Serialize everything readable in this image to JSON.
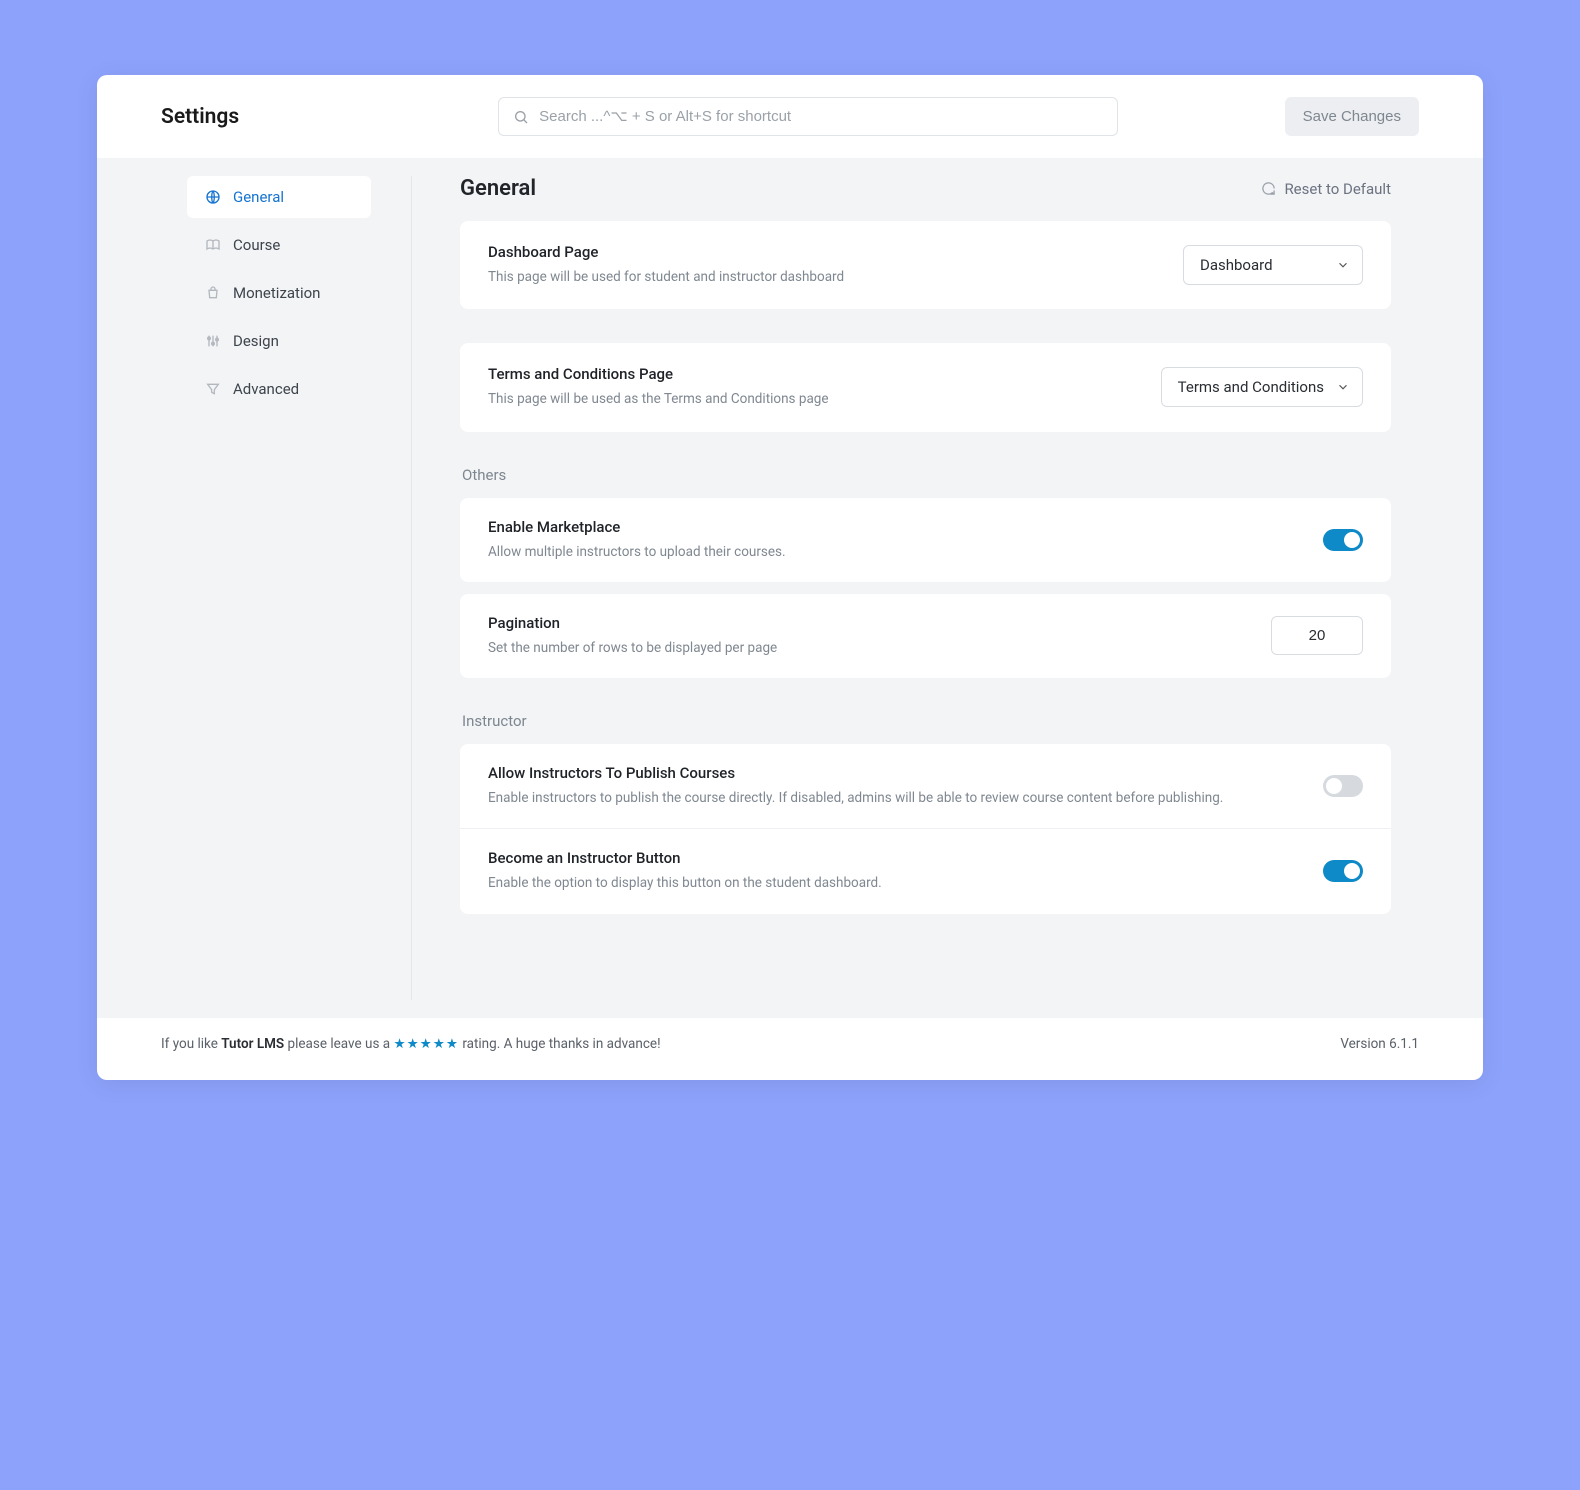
{
  "header": {
    "title": "Settings",
    "search_placeholder": "Search ...^⌥ + S or Alt+S for shortcut",
    "save_label": "Save Changes"
  },
  "sidebar": {
    "items": [
      {
        "id": "general",
        "label": "General",
        "active": true
      },
      {
        "id": "course",
        "label": "Course",
        "active": false
      },
      {
        "id": "monetization",
        "label": "Monetization",
        "active": false
      },
      {
        "id": "design",
        "label": "Design",
        "active": false
      },
      {
        "id": "advanced",
        "label": "Advanced",
        "active": false
      }
    ]
  },
  "main": {
    "title": "General",
    "reset_label": "Reset to Default",
    "rows": {
      "dashboard": {
        "title": "Dashboard Page",
        "desc": "This page will be used for student and instructor dashboard",
        "select_value": "Dashboard"
      },
      "terms": {
        "title": "Terms and Conditions Page",
        "desc": "This page will be used as the Terms and Conditions page",
        "select_value": "Terms and Conditions"
      }
    },
    "sections": {
      "others_label": "Others",
      "instructor_label": "Instructor"
    },
    "others": {
      "marketplace": {
        "title": "Enable Marketplace",
        "desc": "Allow multiple instructors to upload their courses.",
        "enabled": true
      },
      "pagination": {
        "title": "Pagination",
        "desc": "Set the number of rows to be displayed per page",
        "value": "20"
      }
    },
    "instructor": {
      "allow_publish": {
        "title": "Allow Instructors To Publish Courses",
        "desc": "Enable instructors to publish the course directly. If disabled, admins will be able to review course content before publishing.",
        "enabled": false
      },
      "become_button": {
        "title": "Become an Instructor Button",
        "desc": "Enable the option to display this button on the student dashboard.",
        "enabled": true
      }
    }
  },
  "footer": {
    "prefix": "If you like ",
    "brand": "Tutor LMS",
    "mid": " please leave us a ",
    "stars": "★★★★★",
    "suffix": " rating. A huge thanks in advance!",
    "version": "Version 6.1.1"
  }
}
